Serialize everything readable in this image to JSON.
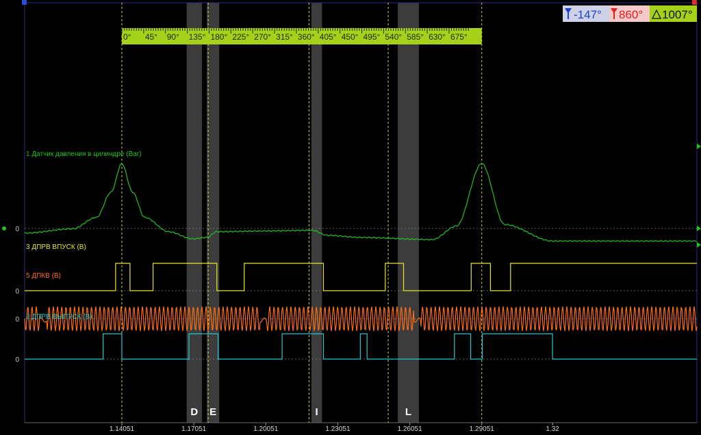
{
  "badges": {
    "cursor_a": "-147°",
    "cursor_b": "860°",
    "delta": "1007°",
    "colors": {
      "a": "#1a3fd0",
      "b": "#e02020",
      "delta": "#111111"
    }
  },
  "chart_data": {
    "type": "line",
    "x_tick_labels": [
      "1.14051",
      "1.17051",
      "1.20051",
      "1.23051",
      "1.26051",
      "1.29051",
      "1.32"
    ],
    "x_ticks": [
      1.14051,
      1.17051,
      1.20051,
      1.23051,
      1.26051,
      1.29051,
      1.32
    ],
    "xlim": [
      1.1,
      1.32
    ],
    "angle_scale": {
      "labels": [
        "0°",
        "45°",
        "90°",
        "135°",
        "180°",
        "225°",
        "270°",
        "315°",
        "360°",
        "405°",
        "450°",
        "495°",
        "540°",
        "585°",
        "630°",
        "675°"
      ],
      "colors": {
        "bg": "#a5d11a",
        "text": "#1a2a00"
      }
    },
    "cursor_x": [
      1.14051,
      1.29051
    ],
    "marker_x": [
      1.17651,
      1.21851,
      1.25151
    ],
    "shaded_regions": [
      {
        "label": "D",
        "x0": 1.16751,
        "x1": 1.17391
      },
      {
        "label": "E",
        "x0": 1.17591,
        "x1": 1.18111
      },
      {
        "label": "I",
        "x0": 1.21951,
        "x1": 1.22391
      },
      {
        "label": "L",
        "x0": 1.25551,
        "x1": 1.26431
      }
    ],
    "series": [
      {
        "name": "1 Датчик давления в цилиндре (Bar)",
        "color": "#22c322",
        "zero_label": "0",
        "kind": "pressure",
        "peaks_x": [
          1.14051,
          1.29051
        ],
        "points": [
          [
            1.1,
            0.3
          ],
          [
            1.12,
            0.9
          ],
          [
            1.13,
            2.5
          ],
          [
            1.136,
            6
          ],
          [
            1.14051,
            10
          ],
          [
            1.145,
            6
          ],
          [
            1.15,
            2.5
          ],
          [
            1.16,
            0.5
          ],
          [
            1.17,
            -0.5
          ],
          [
            1.176,
            -0.3
          ],
          [
            1.18,
            0.5
          ],
          [
            1.2,
            0.6
          ],
          [
            1.22,
            0.7
          ],
          [
            1.226,
            0
          ],
          [
            1.24,
            -0.3
          ],
          [
            1.27,
            -0.6
          ],
          [
            1.28,
            1.3
          ],
          [
            1.29051,
            10
          ],
          [
            1.3,
            1.5
          ],
          [
            1.32,
            -0.8
          ]
        ]
      },
      {
        "name": "3 ДПРВ ВПУСК (В)",
        "color": "#e8e82a",
        "zero_label": "0",
        "kind": "digital",
        "edges_x": [
          1.13791,
          1.14391,
          1.15351,
          1.18011,
          1.19151,
          1.22451,
          1.25031,
          1.25791,
          1.28611,
          1.29411,
          1.30251
        ],
        "initial": 0
      },
      {
        "name": "5 ДПКВ (В)",
        "color": "#ff6d14",
        "zero_label": "0",
        "kind": "crank",
        "gaps_x": [
          1.10751,
          1.19911,
          1.26331
        ]
      },
      {
        "name": "2 ДПРВ ВЫПУСК (В)",
        "color": "#1ec8d8",
        "zero_label": "0",
        "kind": "digital",
        "edges_x": [
          1.1327,
          1.14051,
          1.16851,
          1.18061,
          1.20731,
          1.22451,
          1.23991,
          1.24271,
          1.27911,
          1.28591,
          1.29071,
          1.32
        ],
        "initial": 0,
        "edges_x_note": ""
      }
    ]
  }
}
